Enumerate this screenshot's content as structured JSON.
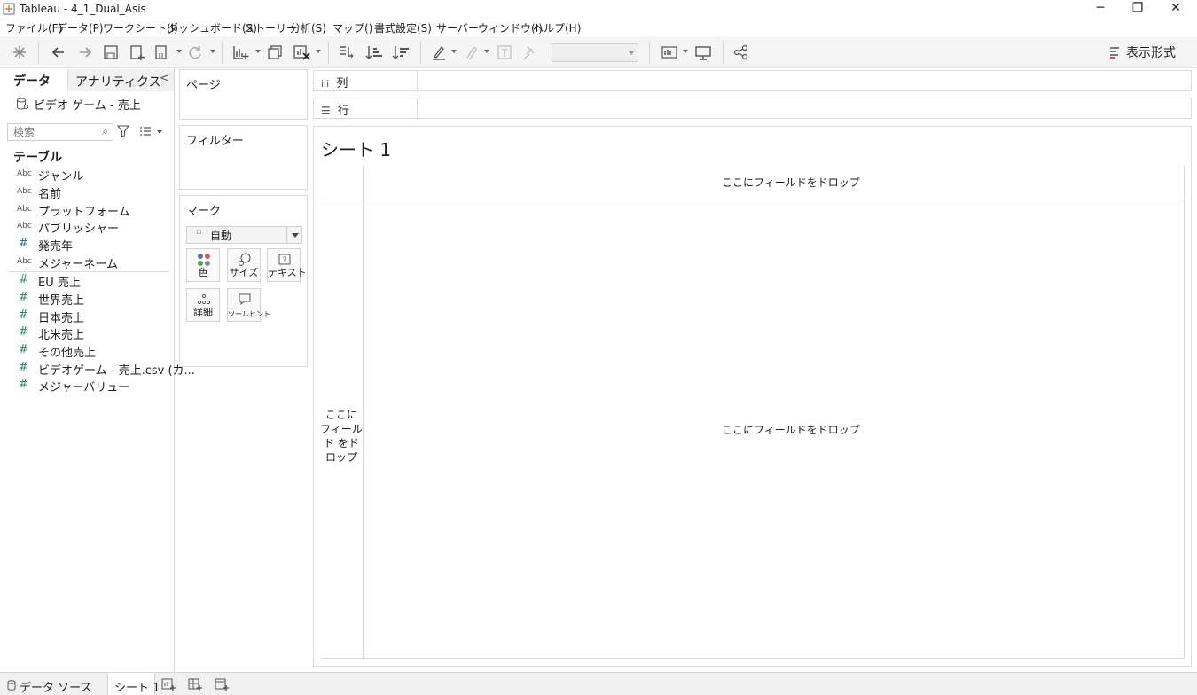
{
  "window": {
    "title": "Tableau - 4_1_Dual_Asis",
    "minimize_glyph": "─",
    "restore_glyph": "❐",
    "close_glyph": "✕"
  },
  "menu": [
    "ファイル(F)",
    "データ(P)",
    "ワークシート(I)",
    "ダッシュボード(S)",
    "ストーリー",
    "分析(S)",
    "マップ()",
    "書式設定(S)",
    "サーバー",
    "ウィンドウ(I)",
    "ヘルプ(H)"
  ],
  "toolbar": {
    "show_me_label": "表示形式"
  },
  "data_pane": {
    "tab_data": "データ",
    "tab_analytics": "アナリティクス",
    "collapse_glyph": "<",
    "datasource_name": "ビデオ ゲーム - 売上",
    "search_placeholder": "検索",
    "tables_heading": "テーブル",
    "dimensions": [
      {
        "type": "Abc",
        "name": "ジャンル"
      },
      {
        "type": "Abc",
        "name": "名前"
      },
      {
        "type": "Abc",
        "name": "プラットフォーム"
      },
      {
        "type": "Abc",
        "name": "パブリッシャー"
      },
      {
        "type": "#",
        "name": "発売年"
      },
      {
        "type": "Abc",
        "name": "メジャーネーム"
      }
    ],
    "measures": [
      {
        "type": "#",
        "name": "EU 売上"
      },
      {
        "type": "#",
        "name": "世界売上"
      },
      {
        "type": "#",
        "name": "日本売上"
      },
      {
        "type": "#",
        "name": "北米売上"
      },
      {
        "type": "#",
        "name": "その他売上"
      },
      {
        "type": "#",
        "name": "ビデオゲーム - 売上.csv (カ..."
      },
      {
        "type": "#",
        "name": "メジャーバリュー"
      }
    ]
  },
  "cards": {
    "pages": "ページ",
    "filters": "フィルター",
    "marks": "マーク",
    "mark_type": "自動",
    "color": "色",
    "size": "サイズ",
    "text": "テキスト",
    "detail": "詳細",
    "tooltip": "ツールヒント"
  },
  "shelves": {
    "columns_icon": "iii",
    "columns": "列",
    "rows_icon": "☰",
    "rows": "行"
  },
  "view": {
    "sheet_title": "シート 1",
    "drop_field_columns": "ここにフィールドをドロップ",
    "drop_field_main": "ここにフィールドをドロップ",
    "drop_field_rows": "ここに フィールド をドロップ"
  },
  "bottom_tabs": {
    "data_source": "データ ソース",
    "sheet1": "シート 1"
  },
  "colors": {
    "measure_green": "#2c8a6c",
    "toolbar_bg": "#f5f5f5",
    "border": "#dadada"
  }
}
